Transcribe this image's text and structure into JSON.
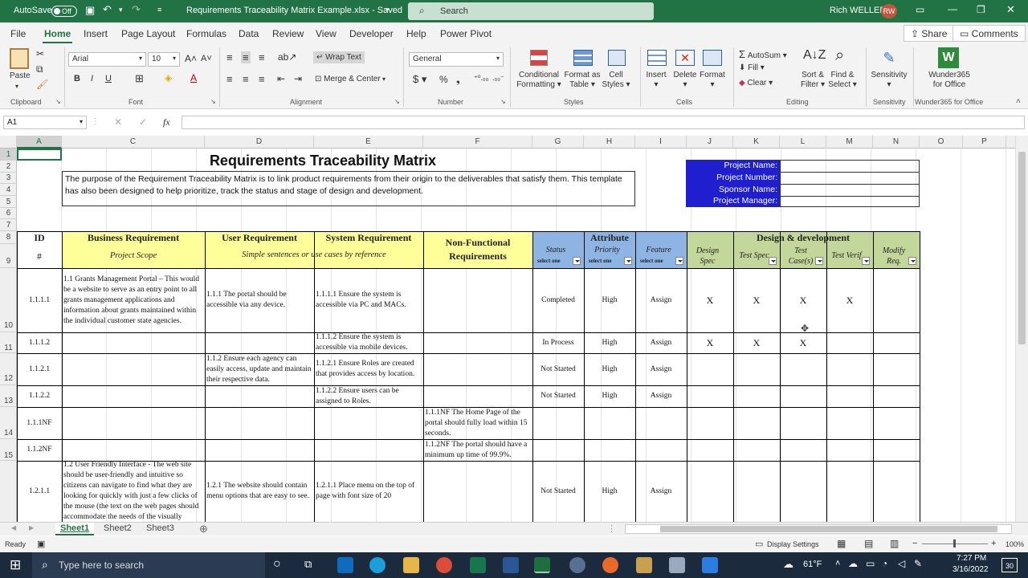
{
  "titlebar": {
    "autosave": "AutoSave",
    "toggle": "Off",
    "filename": "Requirements Traceability Matrix Example.xlsx  -  Saved",
    "search": "Search",
    "user": "Rich WELLER",
    "initials": "RW"
  },
  "menu": {
    "tabs": [
      "File",
      "Home",
      "Insert",
      "Page Layout",
      "Formulas",
      "Data",
      "Review",
      "View",
      "Developer",
      "Help",
      "Power Pivot"
    ],
    "share": "Share",
    "comments": "Comments"
  },
  "ribbon": {
    "paste": "Paste",
    "clipboard": "Clipboard",
    "font_name": "Arial",
    "font_size": "10",
    "font": "Font",
    "wrap": "Wrap Text",
    "merge": "Merge & Center",
    "alignment": "Alignment",
    "numfmt": "General",
    "number": "Number",
    "cond": "Conditional",
    "cond2": "Formatting",
    "fmt_table": "Format as",
    "fmt_table2": "Table",
    "cell_styles": "Cell",
    "cell_styles2": "Styles",
    "styles": "Styles",
    "insert": "Insert",
    "delete": "Delete",
    "format": "Format",
    "cells": "Cells",
    "autosum": "AutoSum",
    "fill": "Fill",
    "clear": "Clear",
    "sort": "Sort &",
    "sort2": "Filter",
    "find": "Find &",
    "find2": "Select",
    "editing": "Editing",
    "sensitivity": "Sensitivity",
    "sensitivity_grp": "Sensitivity",
    "wunder": "Wunder365",
    "wunder2": "for Office",
    "wunder_grp": "Wunder365 for Office"
  },
  "formula_bar": {
    "namebox": "A1",
    "fx": "fx",
    "value": ""
  },
  "columns": [
    "A",
    "C",
    "D",
    "E",
    "F",
    "G",
    "H",
    "I",
    "J",
    "K",
    "L",
    "M",
    "N",
    "O",
    "P"
  ],
  "rows": [
    "1",
    "2",
    "3",
    "4",
    "5",
    "6",
    "7",
    "8",
    "9",
    "10",
    "11",
    "12",
    "13",
    "14",
    "15"
  ],
  "sheet": {
    "title": "Requirements Traceability Matrix",
    "purpose": "The purpose of the Requirement Traceability Matrix is to link product requirements from their origin to the deliverables that satisfy them.  This template has also been designed to help prioritize, track the status and stage of design and development.",
    "project": [
      "Project Name:",
      "Project Number:",
      "Sponsor Name:",
      "Project Manager:"
    ],
    "h_id": "ID",
    "h_hash": "#",
    "h_business": "Business Requirement",
    "h_business_sub": "Project Scope",
    "h_user": "User Requirement",
    "h_system": "System Requirement",
    "h_us_sub": "Simple sentences or use cases by reference",
    "h_nonfunc": "Non-Functional Requirements",
    "h_attr": "Attribute",
    "h_status": "Status",
    "h_priority": "Priority",
    "h_feature": "Feature",
    "select_one": "select one",
    "h_design": "Design & development",
    "h_dspec": "Design Spec",
    "h_tspec": "Test Spec",
    "h_tcase": "Test Case(s)",
    "h_tverif": "Test Verif",
    "h_modify": "Modify Req.",
    "rows": [
      {
        "id": "1.1.1.1",
        "business": "1.1 Grants Management Portal – This would be a website to serve as an entry point to all grants management applications and information about grants maintained within the individual customer state agencies.",
        "user": "1.1.1 The portal should be accessible via any device.",
        "system": "1.1.1.1 Ensure the system is accessible via PC and MACs.",
        "nonfunc": "",
        "status": "Completed",
        "priority": "High",
        "feature": "Assign",
        "ds": "X",
        "ts": "X",
        "tc": "X",
        "tv": "X",
        "mr": ""
      },
      {
        "id": "1.1.1.2",
        "business": "",
        "user": "",
        "system": "1.1.1.2 Ensure the system is accessible via mobile devices.",
        "nonfunc": "",
        "status": "In Process",
        "priority": "High",
        "feature": "Assign",
        "ds": "X",
        "ts": "X",
        "tc": "X",
        "tv": "",
        "mr": ""
      },
      {
        "id": "1.1.2.1",
        "business": "",
        "user": "1.1.2 Ensure each agency can easily access, update and maintain their respective data.",
        "system": "1.1.2.1 Ensure Roles are created that provides access by location.",
        "nonfunc": "",
        "status": "Not Started",
        "priority": "High",
        "feature": "Assign",
        "ds": "",
        "ts": "",
        "tc": "",
        "tv": "",
        "mr": ""
      },
      {
        "id": "1.1.2.2",
        "business": "",
        "user": "",
        "system": "1.1.2.2 Ensure users can be assigned to Roles.",
        "nonfunc": "",
        "status": "Not Started",
        "priority": "High",
        "feature": "Assign",
        "ds": "",
        "ts": "",
        "tc": "",
        "tv": "",
        "mr": ""
      },
      {
        "id": "1.1.1NF",
        "business": "",
        "user": "",
        "system": "",
        "nonfunc": "1.1.1NF The Home Page of the portal should fully load within 15 seconds.",
        "status": "",
        "priority": "",
        "feature": "",
        "ds": "",
        "ts": "",
        "tc": "",
        "tv": "",
        "mr": ""
      },
      {
        "id": "1.1.2NF",
        "business": "",
        "user": "",
        "system": "",
        "nonfunc": "1.1.2NF The portal should have a minimum up time of 99.9%.",
        "status": "",
        "priority": "",
        "feature": "",
        "ds": "",
        "ts": "",
        "tc": "",
        "tv": "",
        "mr": ""
      },
      {
        "id": "1.2.1.1",
        "business": "1.2 User Friendly Interface - The web site should be user-friendly and intuitive so citizens can navigate to find what they are looking for quickly with just a few clicks of the mouse (the text on the web pages should accommodate the needs of the visually",
        "user": "1.2.1 The website should contain menu options that are easy to see.",
        "system": "1.2.1.1 Place menu on the top of page with font size of 20",
        "nonfunc": "",
        "status": "Not Started",
        "priority": "High",
        "feature": "Assign",
        "ds": "",
        "ts": "",
        "tc": "",
        "tv": "",
        "mr": ""
      }
    ]
  },
  "sheets": [
    "Sheet1",
    "Sheet2",
    "Sheet3"
  ],
  "status": {
    "ready": "Ready",
    "display": "Display Settings",
    "zoom": "100%"
  },
  "taskbar": {
    "search": "Type here to search",
    "temp": "61°F",
    "time": "7:27 PM",
    "date": "3/16/2022",
    "notif": "30"
  }
}
